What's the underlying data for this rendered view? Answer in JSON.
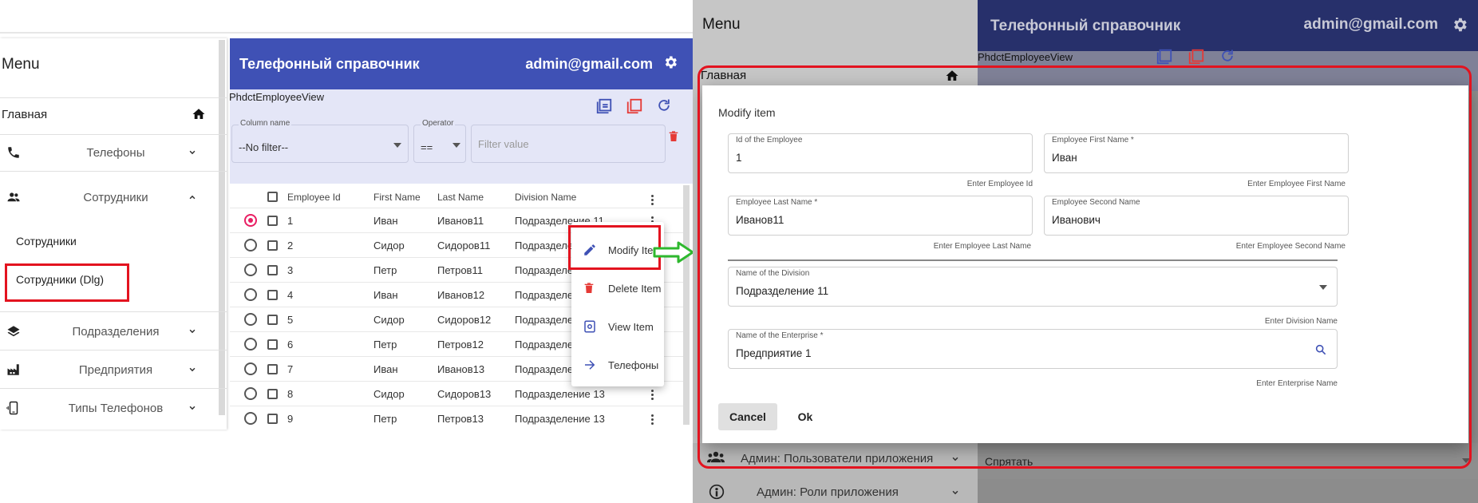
{
  "left": {
    "menu": {
      "title": "Menu",
      "items": [
        {
          "label": "Главная",
          "icon": "home-icon"
        },
        {
          "label": "Телефоны",
          "icon": "phone-icon"
        },
        {
          "label": "Сотрудники",
          "icon": "people-icon"
        },
        {
          "label": "Сотрудники",
          "icon": ""
        },
        {
          "label": "Сотрудники (Dlg)",
          "icon": ""
        },
        {
          "label": "Подразделения",
          "icon": "layers-icon"
        },
        {
          "label": "Предприятия",
          "icon": "factory-icon"
        },
        {
          "label": "Типы Телефонов",
          "icon": "phone-android-icon"
        }
      ]
    },
    "header": {
      "title": "Телефонный справочник",
      "email": "admin@gmail.com"
    },
    "view_name": "PhdctEmployeeView",
    "filter": {
      "column_label": "Column name",
      "column_value": "--No filter--",
      "operator_label": "Operator",
      "operator_value": "==",
      "value_placeholder": "Filter value"
    },
    "table": {
      "columns": [
        "Employee Id",
        "First Name",
        "Last Name",
        "Division Name"
      ],
      "rows": [
        [
          "1",
          "Иван",
          "Иванов11",
          "Подразделение 11"
        ],
        [
          "2",
          "Сидор",
          "Сидоров11",
          "Подразделение 11"
        ],
        [
          "3",
          "Петр",
          "Петров11",
          "Подразделение 11"
        ],
        [
          "4",
          "Иван",
          "Иванов12",
          "Подразделение 12"
        ],
        [
          "5",
          "Сидор",
          "Сидоров12",
          "Подразделение 12"
        ],
        [
          "6",
          "Петр",
          "Петров12",
          "Подразделение 12"
        ],
        [
          "7",
          "Иван",
          "Иванов13",
          "Подразделение 13"
        ],
        [
          "8",
          "Сидор",
          "Сидоров13",
          "Подразделение 13"
        ],
        [
          "9",
          "Петр",
          "Петров13",
          "Подразделение 13"
        ]
      ]
    },
    "context_menu": [
      "Modify Item",
      "Delete Item",
      "View Item",
      "Телефоны"
    ]
  },
  "right": {
    "menu_title": "Menu",
    "menu_home": "Главная",
    "header": {
      "title": "Телефонный справочник",
      "email": "admin@gmail.com"
    },
    "view_name": "PhdctEmployeeView",
    "bottom": {
      "admin_users": "Админ: Пользователи приложения",
      "admin_roles": "Админ: Роли приложения",
      "hide": "Спрятать"
    },
    "dialog": {
      "title": "Modify item",
      "fields": {
        "id": {
          "label": "Id of the Employee",
          "value": "1",
          "hint": "Enter Employee Id"
        },
        "first": {
          "label": "Employee First Name *",
          "value": "Иван",
          "hint": "Enter Employee First Name"
        },
        "last": {
          "label": "Employee Last Name *",
          "value": "Иванов11",
          "hint": "Enter Employee Last Name"
        },
        "second": {
          "label": "Employee Second Name",
          "value": "Иванович",
          "hint": "Enter Employee Second Name"
        },
        "division": {
          "label": "Name of the Division",
          "value": "Подразделение 11",
          "hint": "Enter Division Name"
        },
        "enterprise": {
          "label": "Name of the Enterprise *",
          "value": "Предприятие 1",
          "hint": "Enter Enterprise Name"
        }
      },
      "cancel_label": "Cancel",
      "ok_label": "Ok"
    }
  },
  "colors": {
    "primary": "#3f51b5",
    "highlight": "#e3131f",
    "arrow": "#2eb82e",
    "radio_selected": "#e91e63"
  }
}
